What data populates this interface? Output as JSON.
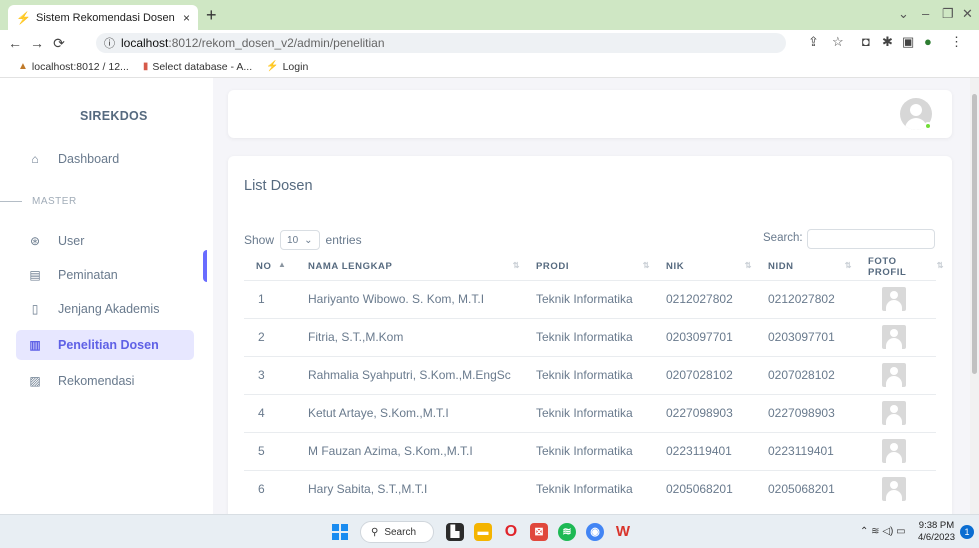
{
  "browser": {
    "tab_title": "Sistem Rekomendasi Dosen",
    "tab_close": "×",
    "new_tab": "+",
    "url_host": "localhost",
    "url_path": ":8012/rekom_dosen_v2/admin/penelitian",
    "bookmarks": [
      "localhost:8012 / 12...",
      "Select database - A...",
      "Login"
    ]
  },
  "sidebar": {
    "brand": "SIREKDOS",
    "items": [
      {
        "label": "Dashboard",
        "icon": "home-icon"
      },
      {
        "label": "User",
        "icon": "user-icon"
      },
      {
        "label": "Peminatan",
        "icon": "clipboard-icon"
      },
      {
        "label": "Jenjang Akademis",
        "icon": "book-icon"
      },
      {
        "label": "Penelitian Dosen",
        "icon": "book-open-icon"
      },
      {
        "label": "Rekomendasi",
        "icon": "document-icon"
      }
    ],
    "section_label": "MASTER",
    "active_index": 4
  },
  "main": {
    "card_title": "List Dosen",
    "show_label": "Show",
    "entries_value": "10",
    "entries_label": "entries",
    "search_label": "Search:",
    "search_value": "",
    "columns": [
      "NO",
      "NAMA LENGKAP",
      "PRODI",
      "NIK",
      "NIDN",
      "FOTO PROFIL"
    ],
    "rows": [
      {
        "no": "1",
        "nama": "Hariyanto Wibowo. S. Kom, M.T.I",
        "prodi": "Teknik Informatika",
        "nik": "0212027802",
        "nidn": "0212027802"
      },
      {
        "no": "2",
        "nama": "Fitria, S.T.,M.Kom",
        "prodi": "Teknik Informatika",
        "nik": "0203097701",
        "nidn": "0203097701"
      },
      {
        "no": "3",
        "nama": "Rahmalia Syahputri, S.Kom.,M.EngSc",
        "prodi": "Teknik Informatika",
        "nik": "0207028102",
        "nidn": "0207028102"
      },
      {
        "no": "4",
        "nama": "Ketut Artaye, S.Kom.,M.T.I",
        "prodi": "Teknik Informatika",
        "nik": "0227098903",
        "nidn": "0227098903"
      },
      {
        "no": "5",
        "nama": "M Fauzan Azima, S.Kom.,M.T.I",
        "prodi": "Teknik Informatika",
        "nik": "0223119401",
        "nidn": "0223119401"
      },
      {
        "no": "6",
        "nama": "Hary Sabita, S.T.,M.T.I",
        "prodi": "Teknik Informatika",
        "nik": "0205068201",
        "nidn": "0205068201"
      }
    ]
  },
  "taskbar": {
    "search_label": "Search",
    "time": "9:38 PM",
    "date": "4/6/2023",
    "notification_count": "1"
  },
  "colors": {
    "accent": "#696cff",
    "active_bg": "#e7e7ff",
    "tabbar": "#cfe7c4"
  }
}
